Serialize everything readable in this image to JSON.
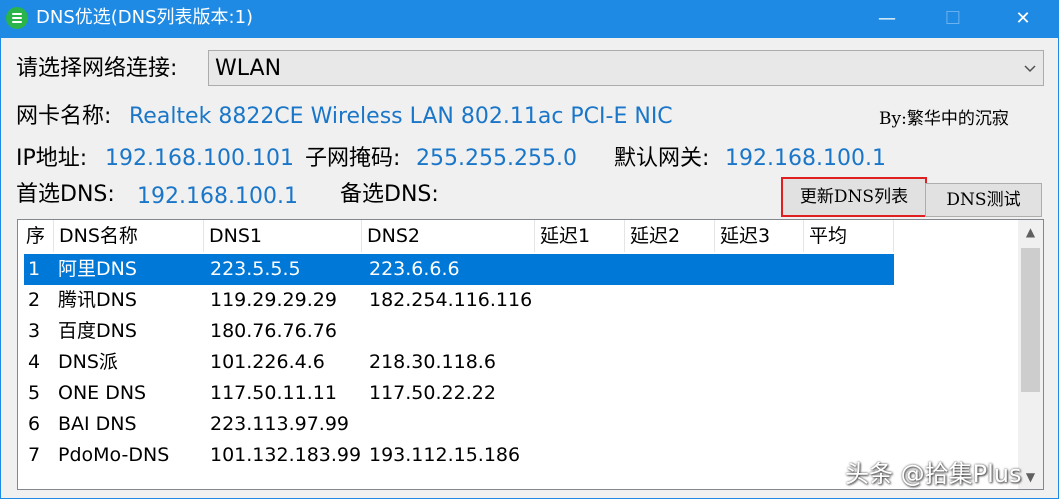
{
  "window": {
    "title": "DNS优选(DNS列表版本:1)",
    "minimize_glyph": "—",
    "maximize_glyph": "☐",
    "close_glyph": "✕",
    "accent_color": "#1e8ae4"
  },
  "network": {
    "select_label": "请选择网络连接:",
    "select_value": "WLAN",
    "nic_label": "网卡名称:",
    "nic_value": "Realtek 8822CE Wireless LAN 802.11ac PCI-E NIC",
    "author": "By:繁华中的沉寂",
    "ip_label": "IP地址:",
    "ip_value": "192.168.100.101",
    "mask_label": "子网掩码:",
    "mask_value": "255.255.255.0",
    "gateway_label": "默认网关:",
    "gateway_value": "192.168.100.1",
    "pdns_label": "首选DNS:",
    "pdns_value": "192.168.100.1",
    "sdns_label": "备选DNS:",
    "sdns_value": ""
  },
  "buttons": {
    "update": "更新DNS列表",
    "test": "DNS测试"
  },
  "table": {
    "columns": [
      "序",
      "DNS名称",
      "DNS1",
      "DNS2",
      "延迟1",
      "延迟2",
      "延迟3",
      "平均"
    ],
    "rows": [
      {
        "idx": "1",
        "name": "阿里DNS",
        "dns1": "223.5.5.5",
        "dns2": "223.6.6.6"
      },
      {
        "idx": "2",
        "name": "腾讯DNS",
        "dns1": "119.29.29.29",
        "dns2": "182.254.116.116"
      },
      {
        "idx": "3",
        "name": "百度DNS",
        "dns1": "180.76.76.76",
        "dns2": ""
      },
      {
        "idx": "4",
        "name": "DNS派",
        "dns1": "101.226.4.6",
        "dns2": "218.30.118.6"
      },
      {
        "idx": "5",
        "name": "ONE DNS",
        "dns1": "117.50.11.11",
        "dns2": "117.50.22.22"
      },
      {
        "idx": "6",
        "name": "BAI DNS",
        "dns1": "223.113.97.99",
        "dns2": ""
      },
      {
        "idx": "7",
        "name": "PdoMo-DNS",
        "dns1": "101.132.183.99",
        "dns2": "193.112.15.186"
      }
    ],
    "selected_row": 1,
    "selection_color": "#0078d7"
  },
  "watermark": "头条 @拾集Plus"
}
